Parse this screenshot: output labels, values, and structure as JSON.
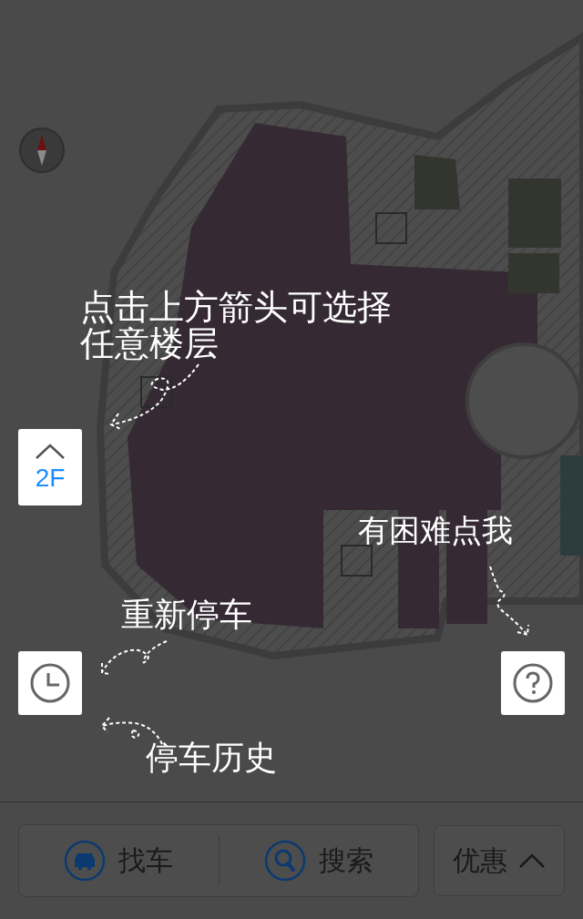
{
  "floor_button": {
    "label": "2F"
  },
  "hints": [
    {
      "text": "点击上方箭头可选择任意楼层"
    },
    {
      "text": "有困难点我"
    },
    {
      "text": "重新停车"
    },
    {
      "text": "停车历史"
    }
  ],
  "bottom_bar": {
    "actions": [
      {
        "kind": "car",
        "label": "找车"
      },
      {
        "kind": "search",
        "label": "搜索"
      }
    ],
    "offers": {
      "label": "优惠"
    }
  }
}
